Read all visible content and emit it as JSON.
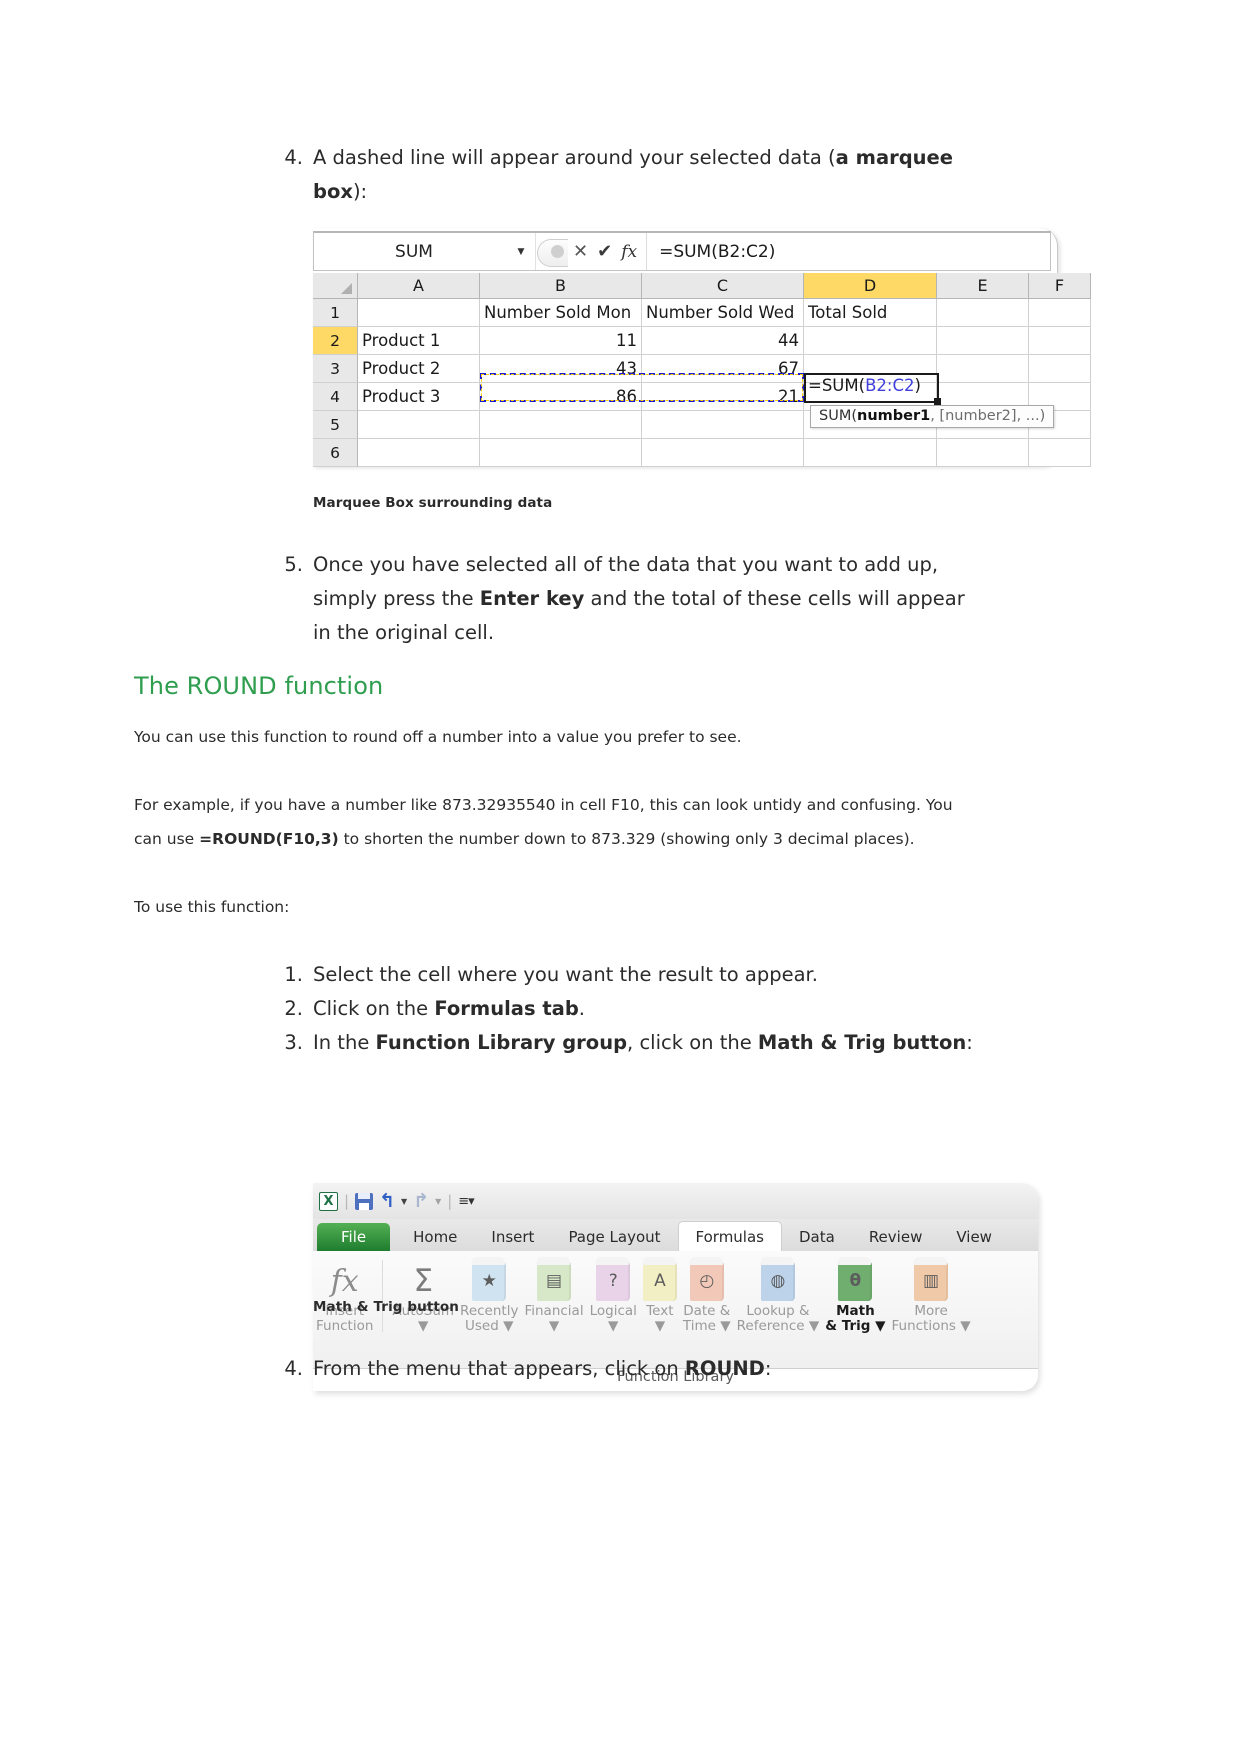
{
  "steps_top": [
    {
      "num": "4.",
      "parts": [
        {
          "t": "A dashed line will appear around your selected data (",
          "b": false
        },
        {
          "t": "a marquee box",
          "b": true
        },
        {
          "t": "):",
          "b": false
        }
      ]
    }
  ],
  "figure1": {
    "caption": "Marquee Box surrounding data",
    "name_box": "SUM",
    "name_box_arrow": "▼",
    "cancel_icon": "✕",
    "enter_icon": "✔",
    "fx_icon": "fx",
    "formula_bar_value": "=SUM(B2:C2)",
    "column_headers": [
      "A",
      "B",
      "C",
      "D",
      "E",
      "F"
    ],
    "selected_column": "D",
    "row_headers": [
      "1",
      "2",
      "3",
      "4",
      "5",
      "6"
    ],
    "selected_row": "2",
    "rows": [
      {
        "A": "",
        "B": "Number Sold Mon",
        "C": "Number Sold Wed",
        "D": "Total Sold",
        "E": "",
        "F": ""
      },
      {
        "A": "Product 1",
        "B": "11",
        "C": "44",
        "D": "",
        "E": "",
        "F": ""
      },
      {
        "A": "Product 2",
        "B": "43",
        "C": "67",
        "D": "",
        "E": "",
        "F": ""
      },
      {
        "A": "Product 3",
        "B": "86",
        "C": "21",
        "D": "",
        "E": "",
        "F": ""
      },
      {
        "A": "",
        "B": "",
        "C": "",
        "D": "",
        "E": "",
        "F": ""
      },
      {
        "A": "",
        "B": "",
        "C": "",
        "D": "",
        "E": "",
        "F": ""
      }
    ],
    "cell_formula_prefix": "=SUM(",
    "cell_formula_ref": "B2:C2",
    "cell_formula_suffix": ")",
    "tooltip_prefix": "SUM(",
    "tooltip_bold": "number1",
    "tooltip_suffix": ", [number2], ...)"
  },
  "steps_after_fig1": [
    {
      "num": "5.",
      "parts": [
        {
          "t": "Once you have selected all of the data that you want to add up, simply press the ",
          "b": false
        },
        {
          "t": "Enter key",
          "b": true
        },
        {
          "t": " and the total of these cells will appear in the original cell.",
          "b": false
        }
      ]
    }
  ],
  "heading": "The ROUND function",
  "heading_color": "#2f9e4f",
  "paragraphs": [
    {
      "parts": [
        {
          "t": "You can use this function to round off a number into a value you prefer to see.",
          "b": false
        }
      ]
    },
    {
      "parts": [
        {
          "t": "For example, if you have a number like 873.32935540 in cell F10, this can look untidy and confusing. You can use ",
          "b": false
        },
        {
          "t": "=ROUND(F10,3)",
          "b": true
        },
        {
          "t": " to shorten the number down to 873.329 (showing only 3 decimal places).",
          "b": false
        }
      ]
    },
    {
      "parts": [
        {
          "t": "To use this function:",
          "b": false
        }
      ]
    }
  ],
  "steps_round": [
    {
      "num": "1.",
      "parts": [
        {
          "t": "Select the cell where you want the result to appear.",
          "b": false
        }
      ]
    },
    {
      "num": "2.",
      "parts": [
        {
          "t": "Click on the ",
          "b": false
        },
        {
          "t": "Formulas tab",
          "b": true
        },
        {
          "t": ".",
          "b": false
        }
      ]
    },
    {
      "num": "3.",
      "parts": [
        {
          "t": "In the ",
          "b": false
        },
        {
          "t": "Function Library group",
          "b": true
        },
        {
          "t": ", click on the ",
          "b": false
        },
        {
          "t": "Math & Trig button",
          "b": true
        },
        {
          "t": ":",
          "b": false
        }
      ]
    }
  ],
  "figure2": {
    "caption": "Math & Trig button",
    "quick_access": {
      "app_logo": "X",
      "save_label": "save-icon",
      "undo_label": "↰",
      "redo_label": "↱",
      "customize_label": "▼"
    },
    "tabs": [
      {
        "label": "File",
        "active": false,
        "file": true
      },
      {
        "label": "Home",
        "active": false,
        "file": false
      },
      {
        "label": "Insert",
        "active": false,
        "file": false
      },
      {
        "label": "Page Layout",
        "active": false,
        "file": false
      },
      {
        "label": "Formulas",
        "active": true,
        "file": false
      },
      {
        "label": "Data",
        "active": false,
        "file": false
      },
      {
        "label": "Review",
        "active": false,
        "file": false
      },
      {
        "label": "View",
        "active": false,
        "file": false
      }
    ],
    "buttons": [
      {
        "label1": "Insert",
        "label2": "Function",
        "glyph": "fx",
        "kind": "fx",
        "color": "",
        "highlight": false,
        "caret": false
      },
      {
        "label1": "AutoSum",
        "label2": "▼",
        "glyph": "Σ",
        "kind": "sigma",
        "color": "",
        "highlight": false,
        "caret": true
      },
      {
        "label1": "Recently",
        "label2": "Used ▼",
        "glyph": "★",
        "kind": "book",
        "color": "#cfe3f0",
        "highlight": false,
        "caret": true
      },
      {
        "label1": "Financial",
        "label2": "▼",
        "glyph": "▤",
        "kind": "book",
        "color": "#d6e8c8",
        "highlight": false,
        "caret": true
      },
      {
        "label1": "Logical",
        "label2": "▼",
        "glyph": "?",
        "kind": "book",
        "color": "#e8d3e8",
        "highlight": false,
        "caret": true
      },
      {
        "label1": "Text",
        "label2": "▼",
        "glyph": "A",
        "kind": "book",
        "color": "#f2efc4",
        "highlight": false,
        "caret": true
      },
      {
        "label1": "Date &",
        "label2": "Time ▼",
        "glyph": "◴",
        "kind": "book",
        "color": "#f2c9b8",
        "highlight": false,
        "caret": true
      },
      {
        "label1": "Lookup &",
        "label2": "Reference ▼",
        "glyph": "◍",
        "kind": "book",
        "color": "#bcd3ea",
        "highlight": false,
        "caret": true
      },
      {
        "label1": "Math",
        "label2": "& Trig ▼",
        "glyph": "θ",
        "kind": "book",
        "color": "#6fae6f",
        "highlight": true,
        "caret": true
      },
      {
        "label1": "More",
        "label2": "Functions ▼",
        "glyph": "▥",
        "kind": "book",
        "color": "#f0c9a8",
        "highlight": false,
        "caret": true
      }
    ],
    "group_label": "Function Library"
  },
  "steps_bottom": [
    {
      "num": "4.",
      "parts": [
        {
          "t": "From the menu that appears, click on ",
          "b": false
        },
        {
          "t": "ROUND",
          "b": true
        },
        {
          "t": ":",
          "b": false
        }
      ]
    }
  ]
}
